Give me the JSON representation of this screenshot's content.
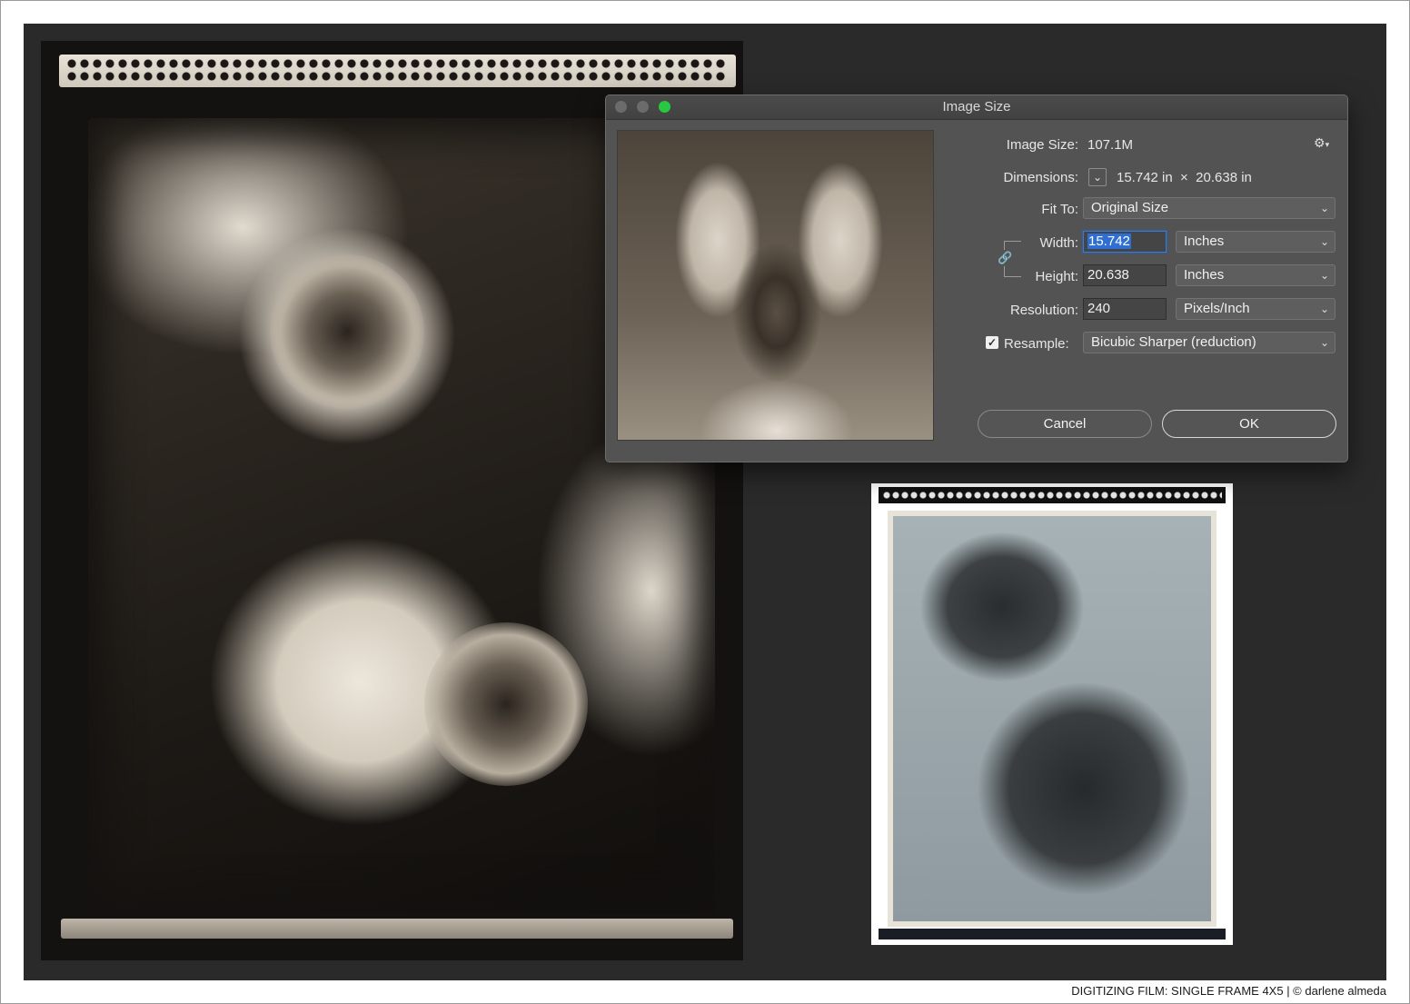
{
  "dialog": {
    "title": "Image Size",
    "image_size_label": "Image Size:",
    "image_size_value": "107.1M",
    "dimensions_label": "Dimensions:",
    "dimensions_value": "15.742 in  ×  20.638 in",
    "fit_to_label": "Fit To:",
    "fit_to_value": "Original Size",
    "width_label": "Width:",
    "width_value": "15.742",
    "width_unit": "Inches",
    "height_label": "Height:",
    "height_value": "20.638",
    "height_unit": "Inches",
    "resolution_label": "Resolution:",
    "resolution_value": "240",
    "resolution_unit": "Pixels/Inch",
    "resample_label": "Resample:",
    "resample_checked": true,
    "resample_value": "Bicubic Sharper (reduction)",
    "cancel_label": "Cancel",
    "ok_label": "OK"
  },
  "icons": {
    "chevron": "chevron-down-icon",
    "gear": "gear-icon",
    "link": "link-chain-icon",
    "check": "checkmark-icon"
  },
  "caption": "DIGITIZING FILM: SINGLE FRAME 4X5 | © darlene almeda",
  "colors": {
    "dialog_bg": "#535353",
    "selection": "#2f6fd1",
    "maximize": "#28c840",
    "canvas_bg": "#2a2a2a"
  }
}
